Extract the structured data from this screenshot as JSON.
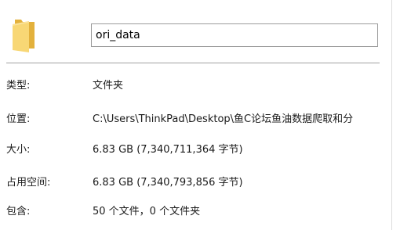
{
  "folder": {
    "icon": "folder-icon",
    "name": "ori_data"
  },
  "properties": {
    "type": {
      "label": "类型:",
      "value": "文件夹"
    },
    "location": {
      "label": "位置:",
      "value": "C:\\Users\\ThinkPad\\Desktop\\鱼C论坛鱼油数据爬取和分"
    },
    "size": {
      "label": "大小:",
      "value": "6.83 GB (7,340,711,364 字节)"
    },
    "disk": {
      "label": "占用空间:",
      "value": "6.83 GB (7,340,793,856 字节)"
    },
    "contains": {
      "label": "包含:",
      "value": "50 个文件，0 个文件夹"
    }
  },
  "colors": {
    "folder_back": "#e3b13c",
    "folder_front": "#f8d775"
  }
}
